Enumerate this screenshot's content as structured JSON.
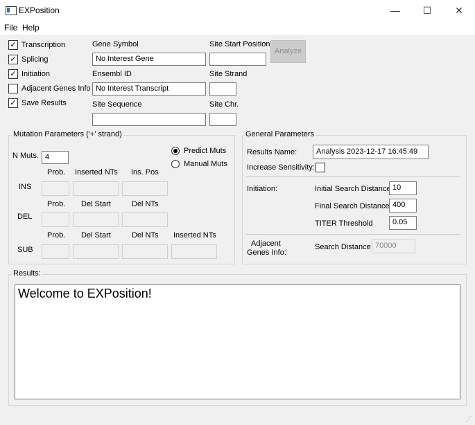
{
  "window": {
    "title": "EXPosition",
    "minimize_glyph": "—",
    "maximize_glyph": "☐",
    "close_glyph": "✕"
  },
  "menu": [
    "File",
    "Help"
  ],
  "options": {
    "transcription": {
      "label": "Transcription",
      "checked": true
    },
    "splicing": {
      "label": "Splicing",
      "checked": true
    },
    "initiation": {
      "label": "Initiation",
      "checked": true
    },
    "adjacent": {
      "label": "Adjacent Genes Info",
      "checked": false
    },
    "save": {
      "label": "Save Results",
      "checked": true
    },
    "check_glyph": "✓"
  },
  "gene": {
    "symbol_label": "Gene Symbol",
    "symbol_value": "No Interest Gene",
    "ensembl_label": "Ensembl ID",
    "ensembl_value": "No Interest Transcript",
    "sequence_label": "Site Sequence",
    "sequence_value": ""
  },
  "site": {
    "start_label": "Site Start Position",
    "start_value": "",
    "strand_label": "Site Strand",
    "strand_value": "",
    "chr_label": "Site Chr.",
    "chr_value": ""
  },
  "analyze_label": "Analyze",
  "mutation": {
    "title": "Mutation Parameters ('+' strand)",
    "nmuts_label": "N Muts.",
    "nmuts_value": "4",
    "predict_label": "Predict Muts",
    "manual_label": "Manual Muts",
    "selected_mode": "predict",
    "ins": {
      "row_label": "INS",
      "headers": [
        "Prob.",
        "Inserted NTs",
        "Ins. Pos"
      ]
    },
    "del": {
      "row_label": "DEL",
      "headers": [
        "Prob.",
        "Del Start",
        "Del NTs"
      ]
    },
    "sub": {
      "row_label": "SUB",
      "headers": [
        "Prob.",
        "Del Start",
        "Del NTs",
        "Inserted NTs"
      ]
    }
  },
  "general": {
    "title": "General Parameters",
    "results_name_label": "Results Name:",
    "results_name_value": "Analysis 2023-12-17 16:45:49",
    "sensitivity_label": "Increase Sensitivity:",
    "sensitivity_checked": false,
    "initiation_label": "Initiation:",
    "initial_label": "Initial Search Distance",
    "initial_value": "10",
    "final_label": "Final Search Distance",
    "final_value": "400",
    "titer_label": "TITER Threshold",
    "titer_value": "0.05",
    "adjacent_label_1": "Adjacent",
    "adjacent_label_2": "Genes Info:",
    "search_label": "Search Distance",
    "search_value": "70000"
  },
  "results": {
    "title": "Results:",
    "text": "Welcome to EXPosition!"
  }
}
